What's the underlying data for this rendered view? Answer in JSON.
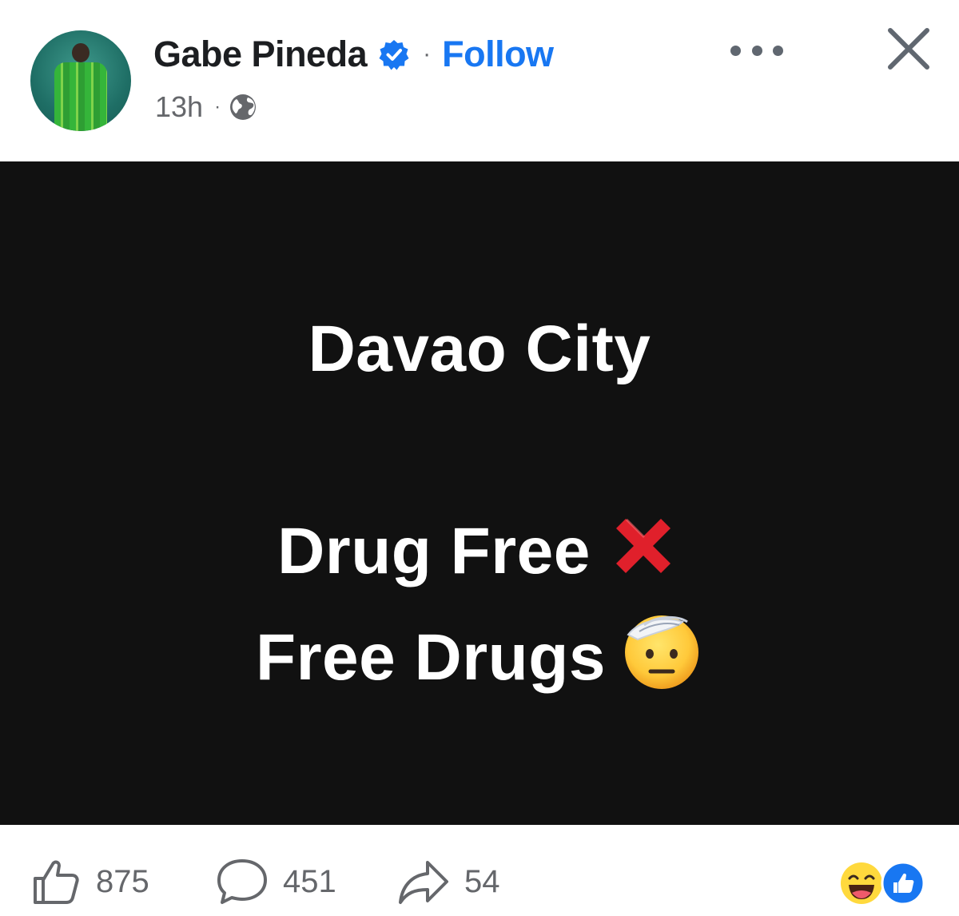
{
  "post": {
    "author": "Gabe Pineda",
    "follow_label": "Follow",
    "separator": "·",
    "time": "13h",
    "meta_separator": "·",
    "verified": true,
    "audience_icon": "globe-icon"
  },
  "content": {
    "title": "Davao City",
    "line1": "Drug Free",
    "line1_emoji": "cross-mark-emoji",
    "line2": "Free Drugs",
    "line2_emoji": "face-with-hand-over-forehead-emoji",
    "background_color": "#111111",
    "text_color": "#ffffff"
  },
  "engagement": {
    "likes": "875",
    "comments": "451",
    "shares": "54",
    "reactions": [
      "laughing-face-emoji",
      "like-reaction-icon"
    ]
  },
  "colors": {
    "accent": "#1877f2",
    "secondary_text": "#65676b",
    "verified_badge": "#1877f2",
    "cross_mark": "#e0202b"
  }
}
